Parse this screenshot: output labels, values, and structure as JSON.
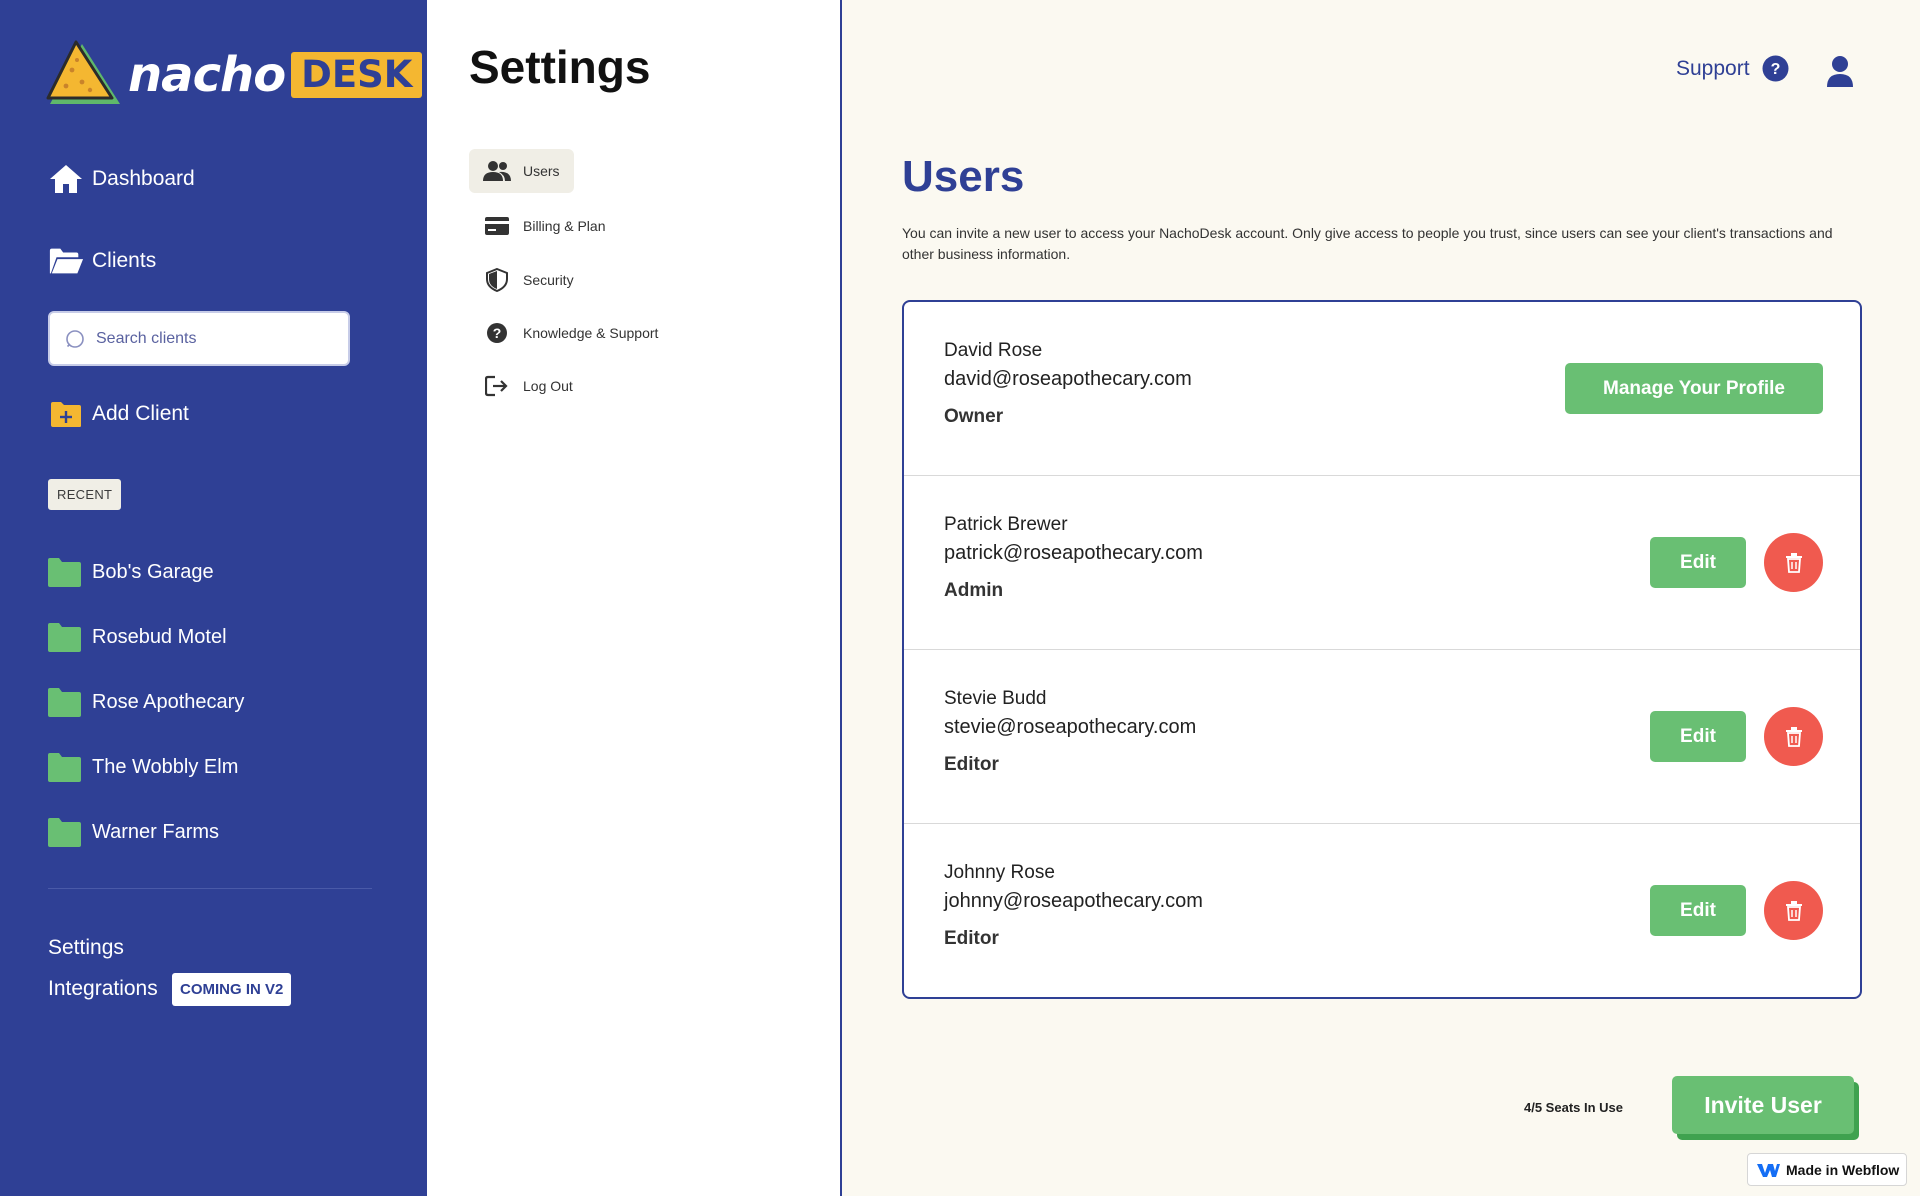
{
  "brand": {
    "logo_word": "nacho",
    "logo_desk": "DESK"
  },
  "sidebar": {
    "nav": [
      {
        "label": "Dashboard",
        "icon": "home-icon"
      },
      {
        "label": "Clients",
        "icon": "folder-open-icon"
      }
    ],
    "search_placeholder": "Search clients",
    "add_client_label": "Add Client",
    "recent_label": "RECENT",
    "recent_clients": [
      "Bob's Garage",
      "Rosebud Motel",
      "Rose Apothecary",
      "The Wobbly Elm",
      "Warner Farms"
    ],
    "settings_label": "Settings",
    "integrations_label": "Integrations",
    "coming_badge": "COMING IN V2"
  },
  "settings": {
    "title": "Settings",
    "menu": [
      {
        "label": "Users",
        "icon": "users-icon"
      },
      {
        "label": "Billing & Plan",
        "icon": "credit-card-icon"
      },
      {
        "label": "Security",
        "icon": "shield-icon"
      },
      {
        "label": "Knowledge & Support",
        "icon": "question-icon"
      },
      {
        "label": "Log Out",
        "icon": "logout-icon"
      }
    ]
  },
  "topbar": {
    "support_label": "Support"
  },
  "main": {
    "title": "Users",
    "description": "You can invite a new user to access your NachoDesk account. Only give access to people you trust, since users can see your client's transactions and other business information.",
    "users": [
      {
        "name": "David Rose",
        "email": "david@roseapothecary.com",
        "role": "Owner",
        "action": "Manage Your Profile"
      },
      {
        "name": "Patrick Brewer",
        "email": "patrick@roseapothecary.com",
        "role": "Admin",
        "action": "Edit"
      },
      {
        "name": "Stevie Budd",
        "email": "stevie@roseapothecary.com",
        "role": "Editor",
        "action": "Edit"
      },
      {
        "name": "Johnny Rose",
        "email": "johnny@roseapothecary.com",
        "role": "Editor",
        "action": "Edit"
      }
    ],
    "seats_text": "4/5 Seats In Use",
    "invite_label": "Invite User"
  },
  "webflow_badge": "Made in Webflow",
  "colors": {
    "sidebar_bg": "#2f4095",
    "accent_green": "#69bf73",
    "delete_red": "#f05a4f",
    "logo_yellow": "#f4b731",
    "page_bg": "#fbf9f1"
  }
}
